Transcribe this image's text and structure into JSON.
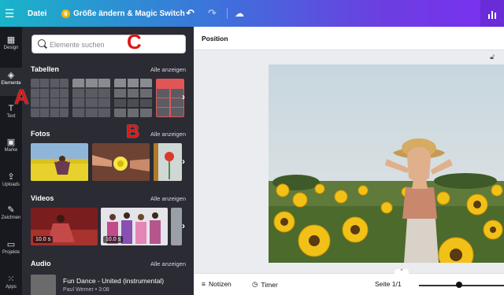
{
  "topbar": {
    "menu_icon": "hamburger-icon",
    "file_label": "Datei",
    "magic_label": "Größe ändern & Magic Switch",
    "undo_icon": "undo-icon",
    "redo_icon": "redo-icon",
    "cloud_icon": "cloud-sync-icon",
    "stats_icon": "bar-chart-icon"
  },
  "rail": {
    "items": [
      {
        "label": "Design",
        "icon": "design-icon"
      },
      {
        "label": "Elemente",
        "icon": "elements-icon"
      },
      {
        "label": "Text",
        "icon": "text-icon"
      },
      {
        "label": "Marke",
        "icon": "brand-icon"
      },
      {
        "label": "Uploads",
        "icon": "upload-icon"
      },
      {
        "label": "Zeichnen",
        "icon": "draw-icon"
      },
      {
        "label": "Projekte",
        "icon": "folder-icon"
      },
      {
        "label": "Apps",
        "icon": "apps-icon"
      }
    ]
  },
  "panel": {
    "search_placeholder": "Elemente suchen",
    "sections": {
      "tables": {
        "title": "Tabellen",
        "link": "Alle anzeigen"
      },
      "photos": {
        "title": "Fotos",
        "link": "Alle anzeigen"
      },
      "videos": {
        "title": "Videos",
        "link": "Alle anzeigen"
      },
      "audio": {
        "title": "Audio",
        "link": "Alle anzeigen"
      }
    },
    "video_durations": [
      "10.0 s",
      "10.0 s"
    ],
    "audio_track": {
      "title": "Fun Dance - United (instrumental)",
      "meta": "Paul Werner • 3:08"
    }
  },
  "annotations": {
    "a": "A",
    "b": "B",
    "c": "C"
  },
  "canvas": {
    "header": "Position",
    "notes_label": "Notizen",
    "timer_label": "Timer",
    "page_label": "Seite 1/1"
  },
  "colors": {
    "accent_red": "#e01515",
    "panel_bg": "#2a2b33",
    "rail_bg": "#18191f"
  }
}
